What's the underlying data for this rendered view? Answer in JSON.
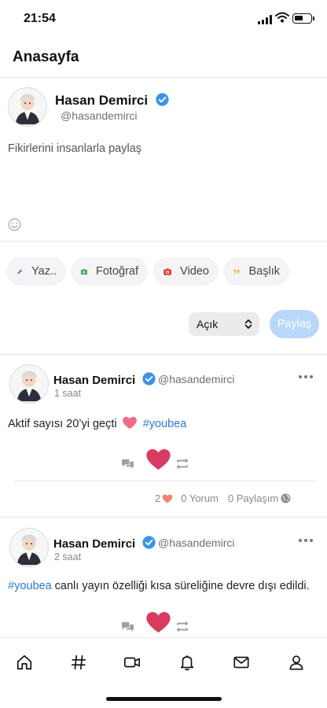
{
  "status_bar": {
    "time": "21:54"
  },
  "header": {
    "title": "Anasayfa"
  },
  "composer": {
    "user_name": "Hasan Demirci",
    "user_handle": "@hasandemirci",
    "placeholder": "Fikirlerini insanlarla paylaş",
    "actions": [
      {
        "label": "Yaz..",
        "icon": "pencil-icon",
        "color": "#3b7ddd"
      },
      {
        "label": "Fotoğraf",
        "icon": "camera-icon",
        "color": "#3aa856"
      },
      {
        "label": "Video",
        "icon": "video-camera-icon",
        "color": "#e03a3a"
      },
      {
        "label": "Başlık",
        "icon": "quote-icon",
        "color": "#f0b429"
      }
    ],
    "visibility_value": "Açık",
    "share_label": "Paylaş"
  },
  "posts": [
    {
      "user_name": "Hasan Demirci",
      "user_handle": "@hasandemirci",
      "time": "1 saat",
      "text": "Aktif sayısı 20’yi geçti",
      "hashtag": "#youbea",
      "like_count": "2",
      "comments": "0 Yorum",
      "shares": "0 Paylaşım"
    },
    {
      "user_name": "Hasan Demirci",
      "user_handle": "@hasandemirci",
      "time": "2 saat",
      "hashtag": "#youbea",
      "text": "canlı yayın özelliği kısa süreliğine devre dışı edildi."
    }
  ],
  "colors": {
    "accent": "#2b7bd6",
    "verified": "#3b93e8",
    "heart": "#d93a5f",
    "share_button": "#b9d7f9"
  },
  "bottom_nav": [
    "home-icon",
    "hashtag-icon",
    "video-icon",
    "bell-icon",
    "mail-icon",
    "profile-icon"
  ]
}
